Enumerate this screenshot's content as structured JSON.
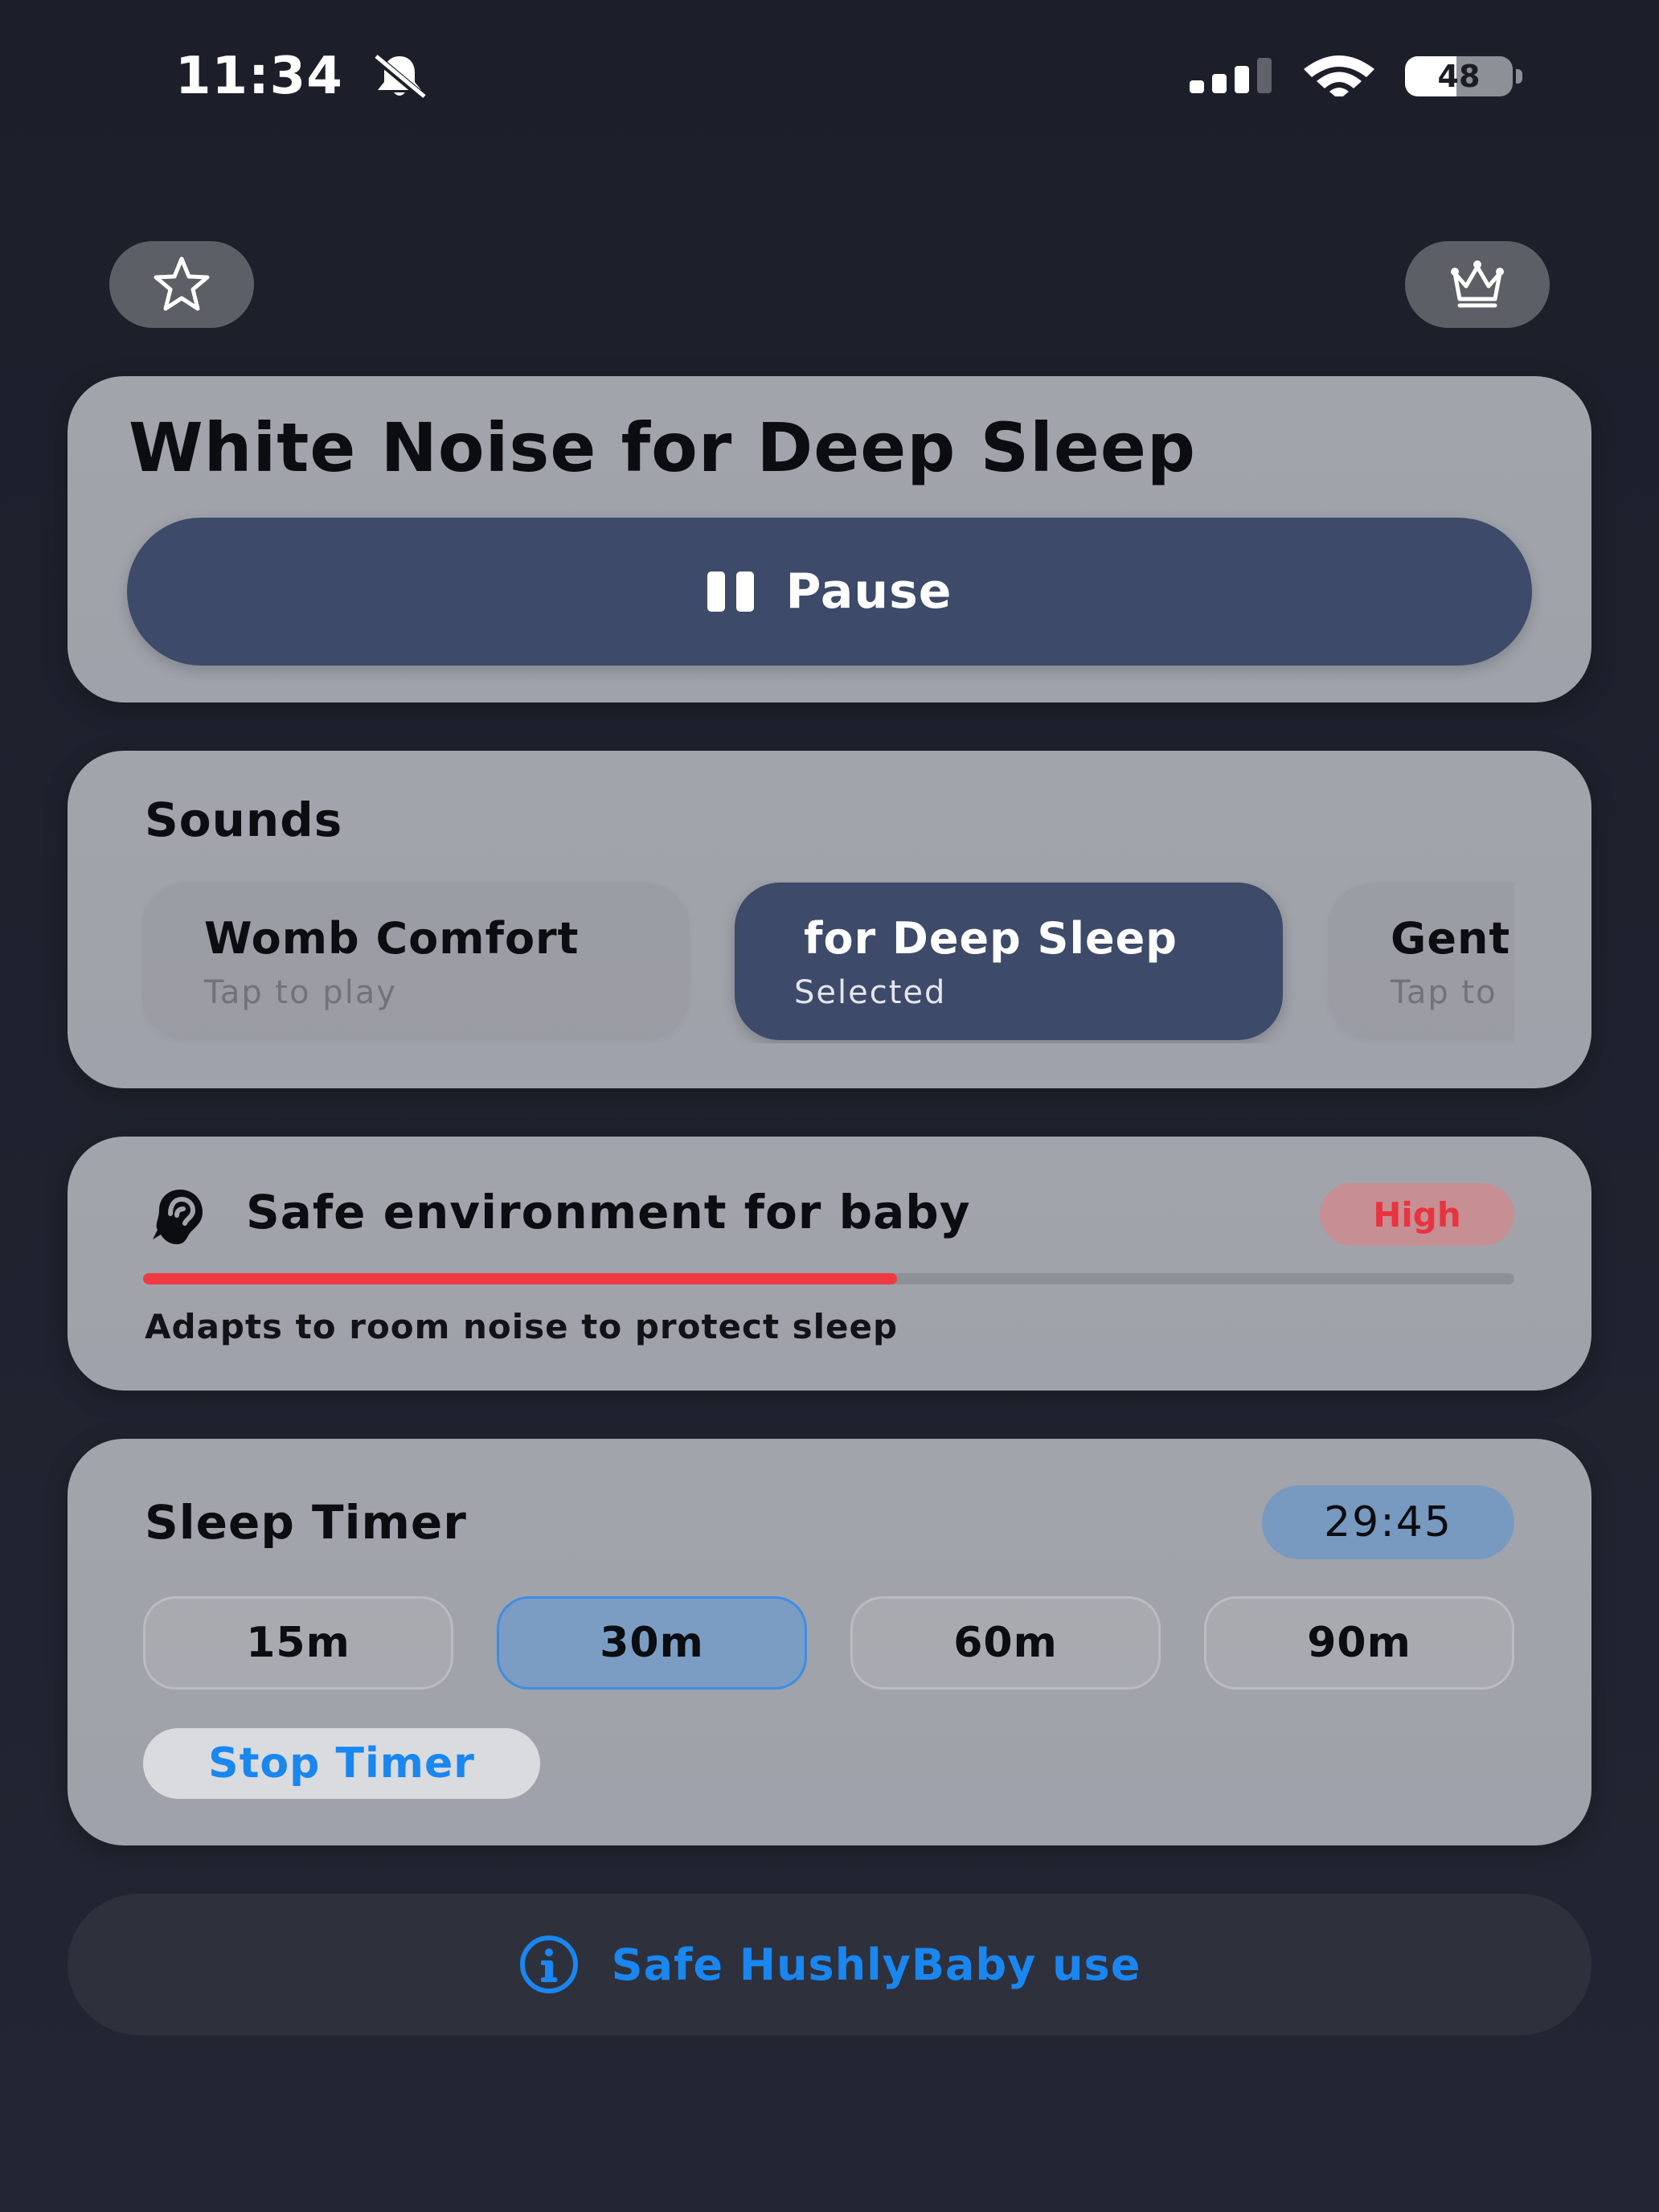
{
  "status_bar": {
    "time": "11:34",
    "battery": "48",
    "battery_level": 0.48
  },
  "icons": {
    "top_left": "star-icon",
    "top_right": "crown-icon",
    "silent": "bell-slash-icon",
    "signal": "cellular-signal-icon",
    "wifi": "wifi-icon",
    "safety": "ear-icon",
    "info": "info-icon"
  },
  "player": {
    "title": "White Noise for Deep Sleep",
    "pause_label": "Pause"
  },
  "sounds": {
    "title": "Sounds",
    "items": [
      {
        "name": "Womb Comfort",
        "subtitle": "Tap to play"
      },
      {
        "name": "for Deep Sleep",
        "subtitle": "Selected"
      },
      {
        "name": "Gent",
        "subtitle": "Tap to"
      }
    ]
  },
  "safety": {
    "title": "Safe environment for baby",
    "level_label": "High",
    "level": 0.55,
    "subtitle": "Adapts to room noise to protect sleep"
  },
  "timer": {
    "title": "Sleep Timer",
    "remaining": "29:45",
    "options": [
      "15m",
      "30m",
      "60m",
      "90m"
    ],
    "selected": "30m",
    "stop_label": "Stop Timer"
  },
  "footer": {
    "info_label": "Safe HushlyBaby use"
  },
  "colors": {
    "background": "#1c1f2a",
    "card": "#a2a4ab",
    "accent_navy": "#3d4a69",
    "accent_blue": "#1a86f0",
    "danger_red": "#ef3a42",
    "timer_badge": "#7899c0"
  }
}
